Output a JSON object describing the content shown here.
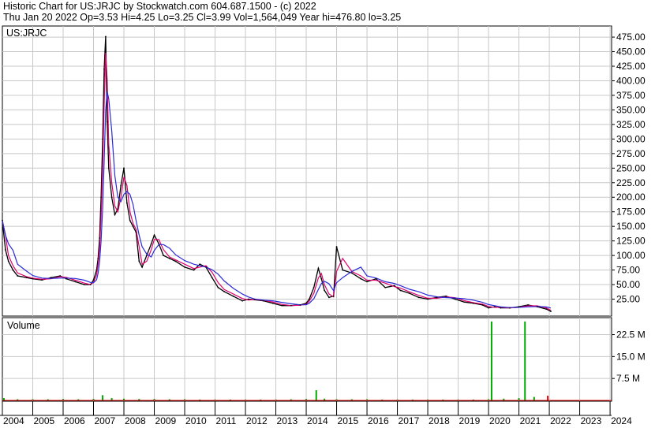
{
  "header": {
    "line1": "Historic Chart for US:JRJC by Stockwatch.com 604.687.1500 - (c) 2022",
    "line2": "Thu Jan 20 2022   Op=3.53   Hi=4.25   Lo=3.25   Cl=3.99   Vol=1,564,049   Year hi=476.80   lo=3.25"
  },
  "colors": {
    "price": "#000000",
    "ma_short": "#e0006e",
    "ma_long": "#2a2ad8",
    "vol_up": "#00aa00",
    "vol_down": "#dd0000",
    "grid": "#c8c8c8"
  },
  "chart_data": [
    {
      "type": "line",
      "panel": "price",
      "label": "US:JRJC",
      "ylim": [
        0,
        490
      ],
      "y_ticks": [
        "25.00",
        "50.00",
        "75.00",
        "100.00",
        "125.00",
        "150.00",
        "175.00",
        "200.00",
        "225.00",
        "250.00",
        "275.00",
        "300.00",
        "325.00",
        "350.00",
        "375.00",
        "400.00",
        "425.00",
        "450.00",
        "475.00"
      ],
      "y_tick_values": [
        25,
        50,
        75,
        100,
        125,
        150,
        175,
        200,
        225,
        250,
        275,
        300,
        325,
        350,
        375,
        400,
        425,
        450,
        475
      ],
      "x": [
        2004.0,
        2004.1,
        2004.2,
        2004.35,
        2004.5,
        2004.8,
        2005.0,
        2005.3,
        2005.6,
        2005.9,
        2006.1,
        2006.4,
        2006.7,
        2006.9,
        2007.0,
        2007.1,
        2007.15,
        2007.2,
        2007.25,
        2007.3,
        2007.35,
        2007.4,
        2007.45,
        2007.5,
        2007.6,
        2007.7,
        2007.8,
        2007.9,
        2008.0,
        2008.1,
        2008.2,
        2008.3,
        2008.4,
        2008.5,
        2008.6,
        2008.75,
        2008.9,
        2009.0,
        2009.15,
        2009.3,
        2009.5,
        2009.7,
        2010.0,
        2010.3,
        2010.5,
        2010.7,
        2010.9,
        2011.1,
        2011.3,
        2011.6,
        2011.9,
        2012.1,
        2012.3,
        2012.6,
        2012.9,
        2013.2,
        2013.5,
        2013.8,
        2014.0,
        2014.1,
        2014.25,
        2014.4,
        2014.5,
        2014.6,
        2014.75,
        2014.9,
        2015.0,
        2015.2,
        2015.5,
        2015.8,
        2016.0,
        2016.3,
        2016.6,
        2016.9,
        2017.1,
        2017.4,
        2017.7,
        2018.0,
        2018.3,
        2018.6,
        2018.9,
        2019.2,
        2019.5,
        2019.8,
        2020.0,
        2020.2,
        2020.4,
        2020.7,
        2021.0,
        2021.3,
        2021.6,
        2021.9,
        2022.05
      ],
      "values": [
        160,
        110,
        90,
        75,
        65,
        62,
        60,
        58,
        62,
        65,
        60,
        55,
        50,
        50,
        58,
        75,
        95,
        130,
        200,
        300,
        420,
        476,
        330,
        250,
        200,
        170,
        180,
        220,
        250,
        190,
        160,
        150,
        140,
        90,
        80,
        100,
        120,
        135,
        120,
        100,
        95,
        90,
        80,
        75,
        85,
        80,
        62,
        45,
        38,
        30,
        22,
        25,
        24,
        22,
        18,
        14,
        14,
        15,
        18,
        25,
        45,
        78,
        60,
        40,
        28,
        30,
        115,
        75,
        70,
        60,
        55,
        60,
        45,
        48,
        40,
        35,
        28,
        25,
        28,
        30,
        25,
        20,
        18,
        15,
        10,
        12,
        10,
        10,
        12,
        15,
        12,
        8,
        4
      ]
    },
    {
      "type": "bar",
      "panel": "volume",
      "label": "Volume",
      "y_ticks": [
        "7.5 M",
        "15.0 M",
        "22.5 M"
      ],
      "y_tick_values": [
        7.5,
        15.0,
        22.5
      ],
      "ylim": [
        0,
        27.5
      ],
      "x": [
        2004.05,
        2004.5,
        2005.0,
        2005.5,
        2006.0,
        2006.5,
        2007.0,
        2007.3,
        2007.6,
        2008.0,
        2008.5,
        2009.0,
        2009.5,
        2010.0,
        2010.5,
        2011.0,
        2011.5,
        2012.0,
        2012.5,
        2013.0,
        2013.5,
        2014.0,
        2014.33,
        2014.6,
        2015.0,
        2015.5,
        2016.0,
        2016.5,
        2017.0,
        2017.5,
        2018.0,
        2018.5,
        2019.0,
        2019.5,
        2020.0,
        2020.1,
        2020.5,
        2021.0,
        2021.2,
        2021.5,
        2021.95
      ],
      "values": [
        0.8,
        0.4,
        0.4,
        0.4,
        0.5,
        0.4,
        0.5,
        1.8,
        0.8,
        0.6,
        0.5,
        0.5,
        0.4,
        0.4,
        0.3,
        0.3,
        0.3,
        0.3,
        0.3,
        0.3,
        0.4,
        0.5,
        3.5,
        0.6,
        0.4,
        0.4,
        0.4,
        0.3,
        0.3,
        0.3,
        0.3,
        0.3,
        0.3,
        0.3,
        0.4,
        27.0,
        0.6,
        0.8,
        27.0,
        1.2,
        1.6
      ]
    }
  ],
  "x_axis": {
    "labels": [
      "2004",
      "2005",
      "2006",
      "2007",
      "2008",
      "2009",
      "2010",
      "2011",
      "2012",
      "2013",
      "2014",
      "2015",
      "2016",
      "2017",
      "2018",
      "2019",
      "2020",
      "2021",
      "2022",
      "2023",
      "2024"
    ],
    "values": [
      2004,
      2005,
      2006,
      2007,
      2008,
      2009,
      2010,
      2011,
      2012,
      2013,
      2014,
      2015,
      2016,
      2017,
      2018,
      2019,
      2020,
      2021,
      2022,
      2023,
      2024
    ]
  }
}
